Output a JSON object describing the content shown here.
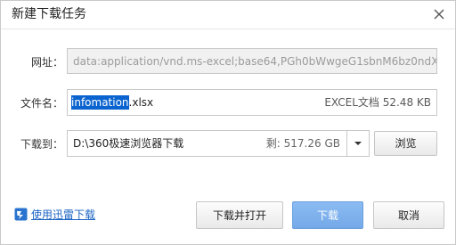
{
  "dialog": {
    "title": "新建下载任务"
  },
  "form": {
    "url_label": "网址：",
    "url_value": "data:application/vnd.ms-excel;base64,PGh0bWwgeG1sbnM6bz0ndXJu",
    "filename_label": "文件名：",
    "filename_selected": "infomation",
    "filename_ext": ".xlsx",
    "file_info": "EXCEL文档 52.48 KB",
    "download_to_label": "下载到：",
    "download_dir": "D:\\360极速浏览器下载",
    "free_space": "剩: 517.26 GB",
    "browse_label": "浏览"
  },
  "footer": {
    "thunder_link": "使用迅雷下载",
    "download_open_label": "下载并打开",
    "download_label": "下载",
    "cancel_label": "取消"
  },
  "colors": {
    "accent": "#74a9e8",
    "link": "#1c64c4",
    "selection": "#0a63cf"
  }
}
